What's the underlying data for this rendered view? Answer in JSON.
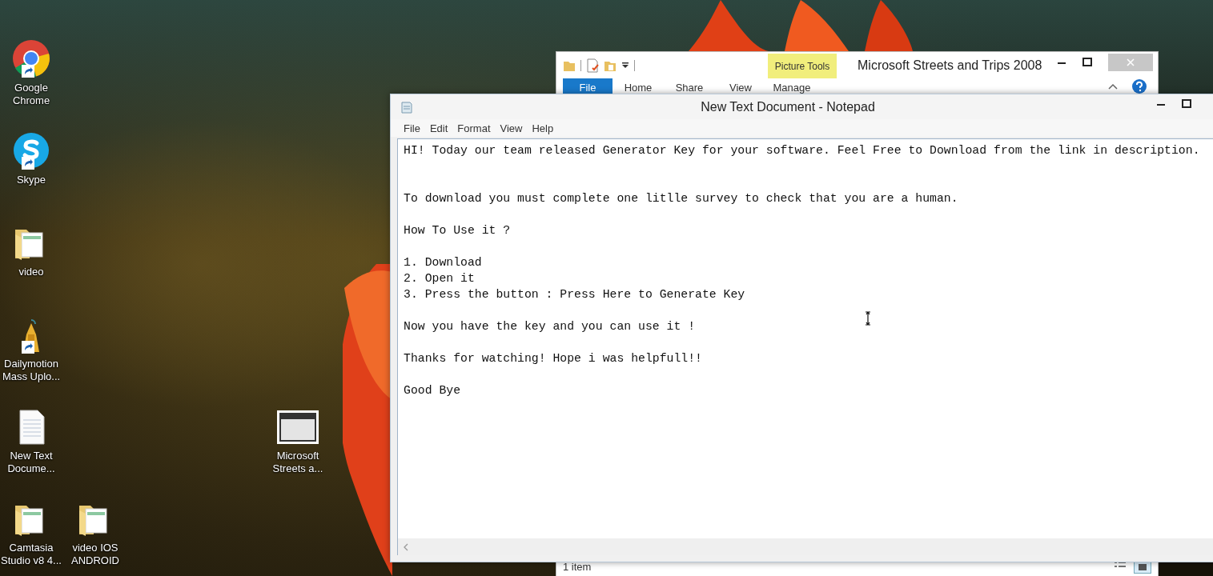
{
  "desktop_icons": [
    {
      "label": "Google\nChrome",
      "kind": "chrome",
      "shortcut": true
    },
    {
      "label": "Skype",
      "kind": "skype",
      "shortcut": true
    },
    {
      "label": "video",
      "kind": "folder",
      "shortcut": false
    },
    {
      "label": "Dailymotion\nMass Uplo...",
      "kind": "uploader",
      "shortcut": true
    },
    {
      "label": "New Text\nDocume...",
      "kind": "textfile",
      "shortcut": false
    },
    {
      "label": "Camtasia\nStudio v8 4...",
      "kind": "folder",
      "shortcut": false
    },
    {
      "label": "video IOS\nANDROID",
      "kind": "folder",
      "shortcut": false
    },
    {
      "label": "Microsoft\nStreets a...",
      "kind": "window",
      "shortcut": false
    }
  ],
  "explorer": {
    "title": "Microsoft Streets and Trips 2008",
    "contextual_tab": "Picture Tools",
    "tabs": [
      {
        "label": "File",
        "kind": "file"
      },
      {
        "label": "Home",
        "kind": "tab"
      },
      {
        "label": "Share",
        "kind": "tab"
      },
      {
        "label": "View",
        "kind": "tab"
      },
      {
        "label": "Manage",
        "kind": "tab"
      }
    ],
    "status": "1 item"
  },
  "notepad": {
    "title": "New Text Document - Notepad",
    "menu": [
      "File",
      "Edit",
      "Format",
      "View",
      "Help"
    ],
    "content": "HI! Today our team released Generator Key for your software. Feel Free to Download from the link in description.\n\n\nTo download you must complete one litlle survey to check that you are a human.\n\nHow To Use it ?\n\n1. Download\n2. Open it\n3. Press the button : Press Here to Generate Key\n\nNow you have the key and you can use it !\n\nThanks for watching! Hope i was helpfull!!\n\nGood Bye"
  }
}
